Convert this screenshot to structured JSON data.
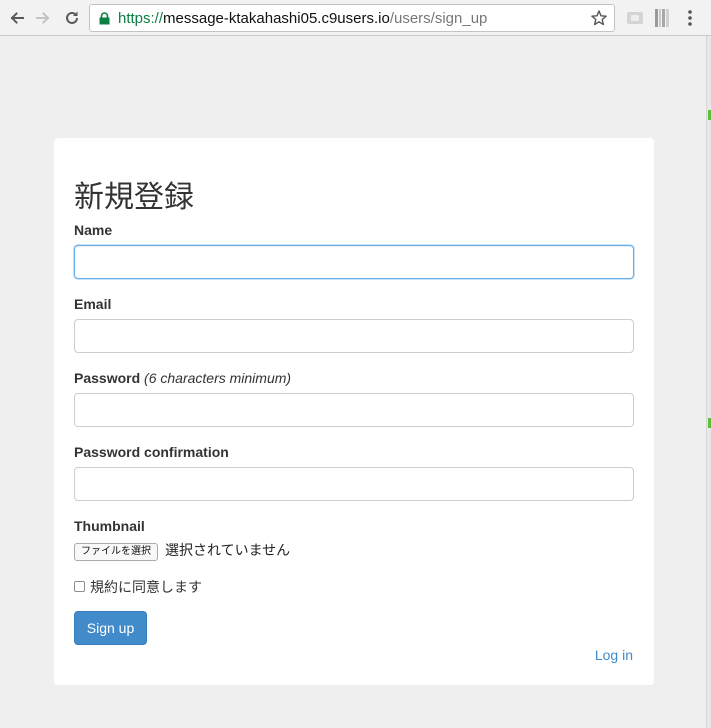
{
  "browser": {
    "url_scheme": "https://",
    "url_host": "message-ktakahashi05.c9users.io",
    "url_path": "/users/sign_up"
  },
  "form": {
    "title": "新規登録",
    "name_label": "Name",
    "email_label": "Email",
    "password_label": "Password",
    "password_hint": "(6 characters minimum)",
    "password_confirmation_label": "Password confirmation",
    "thumbnail_label": "Thumbnail",
    "file_button_label": "ファイルを選択",
    "file_status": "選択されていません",
    "terms_label": "規約に同意します",
    "submit_label": "Sign up",
    "login_link": "Log in"
  },
  "colors": {
    "primary": "#428bca",
    "secure_green": "#0b8043",
    "focus_border": "#66afe9"
  },
  "icons": [
    "back-arrow-icon",
    "forward-arrow-icon",
    "reload-icon",
    "lock-icon",
    "star-icon",
    "cast-icon",
    "extension-icon",
    "menu-dots-icon"
  ]
}
